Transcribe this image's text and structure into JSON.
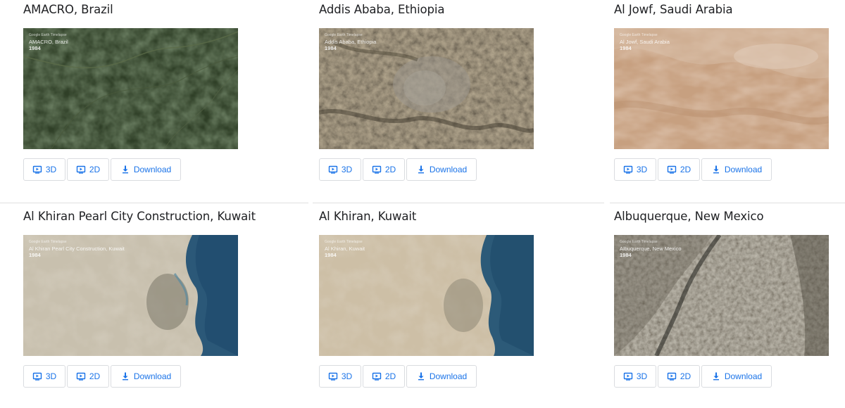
{
  "overlay_brand": "Google Earth Timelapse",
  "year": "1984",
  "buttons": {
    "three_d": "3D",
    "two_d": "2D",
    "download": "Download"
  },
  "cards": [
    {
      "title": "AMACRO, Brazil",
      "overlay_place": "AMACRO, Brazil"
    },
    {
      "title": "Addis Ababa, Ethiopia",
      "overlay_place": "Addis Ababa, Ethiopia"
    },
    {
      "title": "Al Jowf, Saudi Arabia",
      "overlay_place": "Al Jowf, Saudi Arabia"
    },
    {
      "title": "Al Khiran Pearl City Construction, Kuwait",
      "overlay_place": "Al Khiran Pearl City Construction, Kuwait"
    },
    {
      "title": "Al Khiran, Kuwait",
      "overlay_place": "Al Khiran, Kuwait"
    },
    {
      "title": "Albuquerque, New Mexico",
      "overlay_place": "Albuquerque, New Mexico"
    }
  ]
}
